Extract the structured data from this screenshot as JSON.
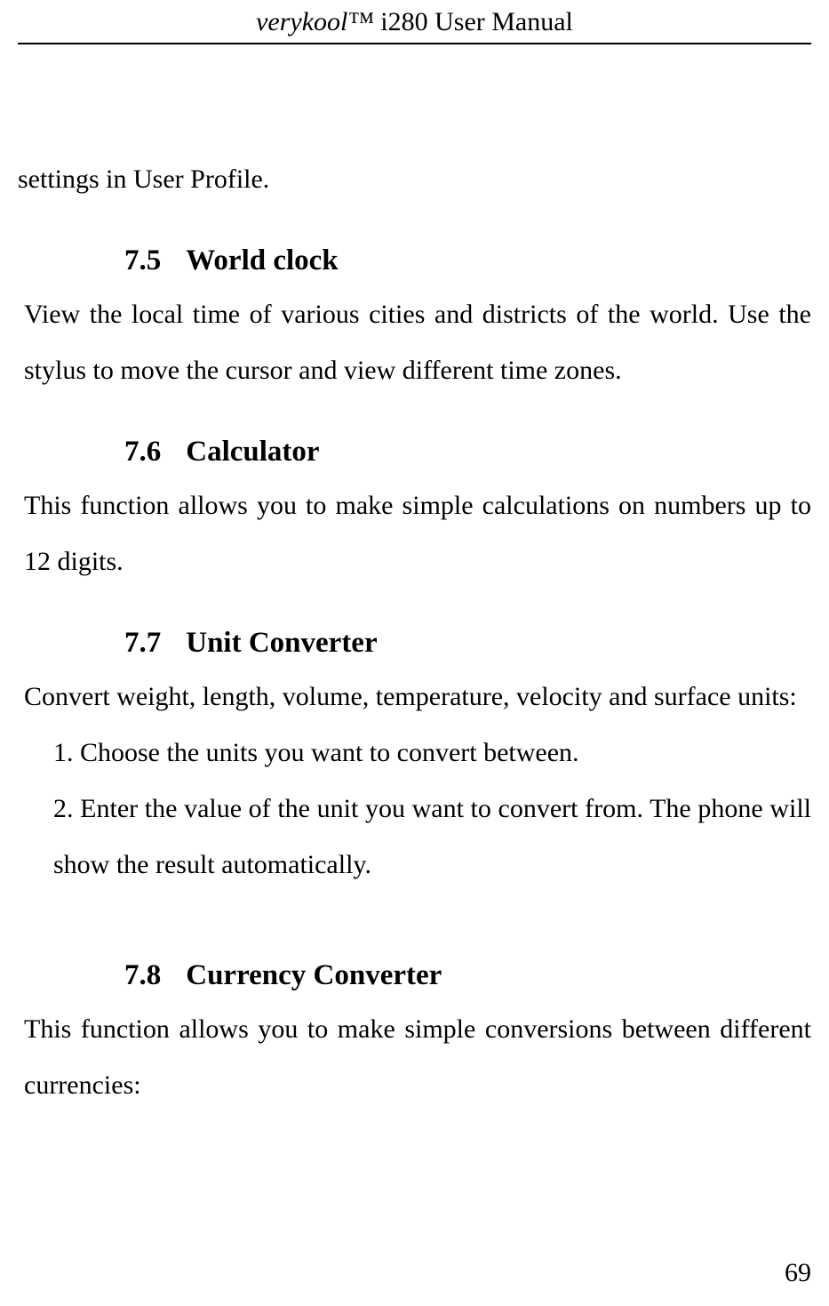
{
  "header": {
    "brand_italic": "verykool™",
    "brand_rest": " i280 User Manual"
  },
  "intro_fragment": "settings in User Profile.",
  "sections": {
    "s75": {
      "num": "7.5",
      "title": "World clock",
      "body": "View the local time of various cities and districts of the world. Use the stylus to move the cursor and view different time zones."
    },
    "s76": {
      "num": "7.6",
      "title": "Calculator",
      "body": "This function allows you to make simple calculations on numbers up to 12 digits."
    },
    "s77": {
      "num": "7.7",
      "title": "Unit Converter",
      "body": "Convert weight, length, volume, temperature, velocity and surface units:",
      "items": [
        {
          "num": "1.",
          "text": "Choose the units you want to convert between."
        },
        {
          "num": "2.",
          "text": "Enter the value of the unit you want to convert from. The phone will show the result automatically."
        }
      ]
    },
    "s78": {
      "num": "7.8",
      "title": "Currency Converter",
      "body": "This function allows you to make simple conversions between different currencies:"
    }
  },
  "page_number": "69"
}
